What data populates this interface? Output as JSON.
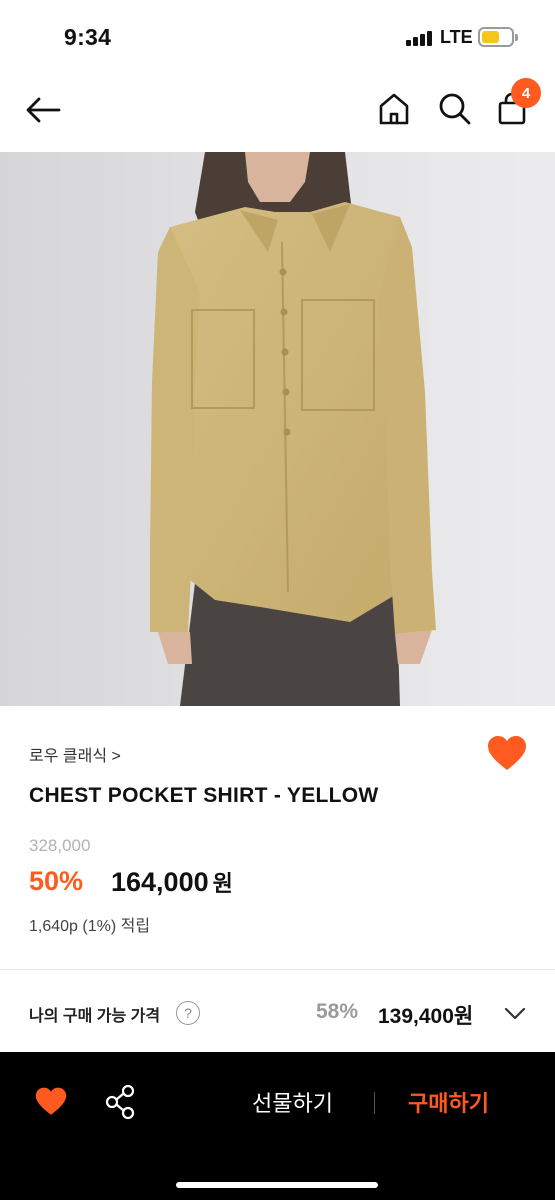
{
  "status_bar": {
    "time": "9:34",
    "network": "LTE",
    "battery_color": "#f5c518"
  },
  "header": {
    "back_icon": "arrow-left-icon",
    "home_icon": "home-icon",
    "search_icon": "search-icon",
    "cart_icon": "shopping-bag-icon",
    "cart_count": "4"
  },
  "product": {
    "image_description_icon": "product-photo",
    "brand": "로우 클래식 >",
    "name": "CHEST POCKET SHIRT - YELLOW",
    "original_price": "328,000",
    "discount_rate": "50%",
    "sale_price": "164,000",
    "currency": "원",
    "points": "1,640p (1%) 적립"
  },
  "my_price": {
    "label": "나의 구매 가능 가격",
    "help": "?",
    "rate": "58%",
    "price": "139,400원"
  },
  "bottom_bar": {
    "gift_label": "선물하기",
    "buy_label": "구매하기",
    "accent_color": "#ff5a1f"
  }
}
